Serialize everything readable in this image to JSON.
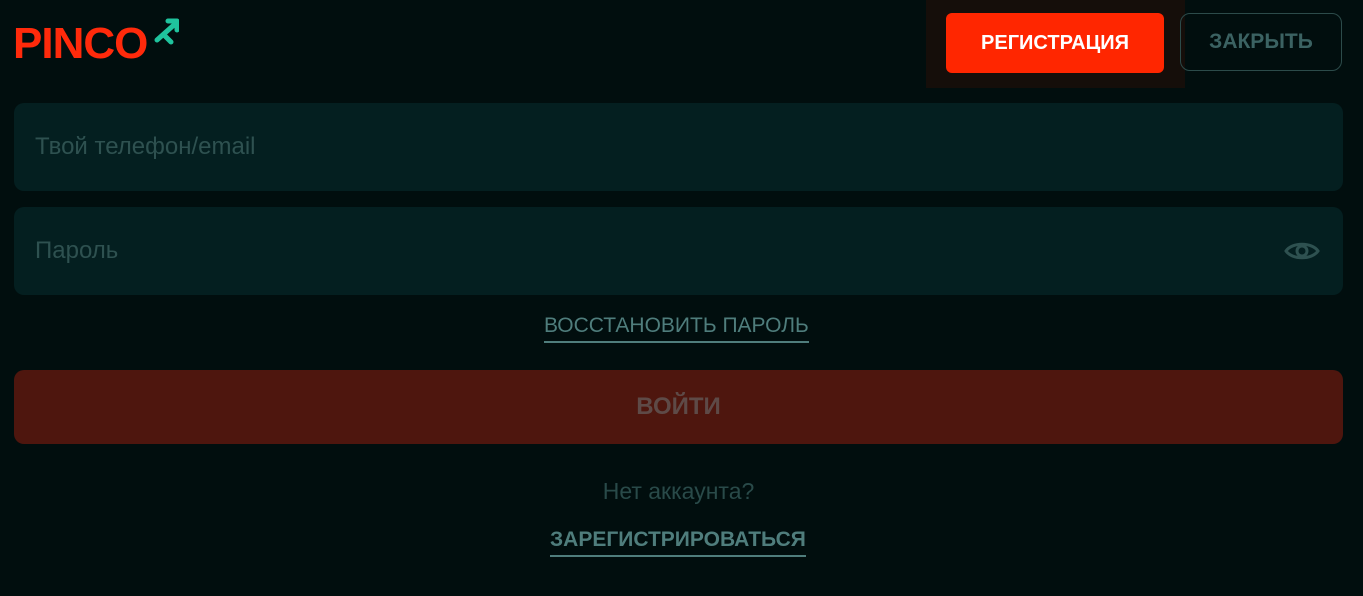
{
  "brand": {
    "logo_text": "PINCO",
    "primary_color": "#ff2a0b",
    "accent_color": "#1fc39d"
  },
  "header": {
    "register_label": "РЕГИСТРАЦИЯ",
    "close_label": "ЗАКРЫТЬ"
  },
  "form": {
    "login_placeholder": "Твой телефон/email",
    "password_placeholder": "Пароль",
    "password_toggle_icon": "eye-icon",
    "recover_label": "ВОССТАНОВИТЬ ПАРОЛЬ",
    "submit_label": "ВОЙТИ"
  },
  "footer": {
    "no_account_text": "Нет аккаунта?",
    "signup_label": "ЗАРЕГИСТРИРОВАТЬСЯ"
  }
}
